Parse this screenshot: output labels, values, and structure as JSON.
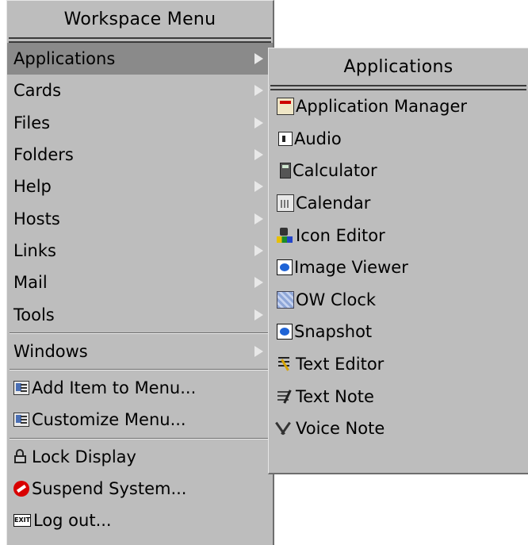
{
  "workspace_menu": {
    "title": "Workspace Menu",
    "submenu_items": [
      {
        "label": "Applications"
      },
      {
        "label": "Cards"
      },
      {
        "label": "Files"
      },
      {
        "label": "Folders"
      },
      {
        "label": "Help"
      },
      {
        "label": "Hosts"
      },
      {
        "label": "Links"
      },
      {
        "label": "Mail"
      },
      {
        "label": "Tools"
      }
    ],
    "windows_item": {
      "label": "Windows"
    },
    "menu_actions": [
      {
        "label": "Add Item to Menu...",
        "icon": "workspace-menu-icon"
      },
      {
        "label": "Customize Menu...",
        "icon": "workspace-menu-icon"
      }
    ],
    "system_actions": [
      {
        "label": "Lock Display",
        "icon": "lock-icon"
      },
      {
        "label": "Suspend System...",
        "icon": "suspend-icon"
      },
      {
        "label": "Log out...",
        "icon": "exit-icon",
        "icon_text": "EXIT"
      }
    ]
  },
  "applications_menu": {
    "title": "Applications",
    "items": [
      {
        "label": "Application Manager",
        "icon": "application-manager-icon"
      },
      {
        "label": "Audio",
        "icon": "audio-icon"
      },
      {
        "label": "Calculator",
        "icon": "calculator-icon"
      },
      {
        "label": "Calendar",
        "icon": "calendar-icon"
      },
      {
        "label": "Icon Editor",
        "icon": "icon-editor-icon"
      },
      {
        "label": "Image Viewer",
        "icon": "image-viewer-icon"
      },
      {
        "label": "OW Clock",
        "icon": "clock-icon"
      },
      {
        "label": "Snapshot",
        "icon": "snapshot-icon"
      },
      {
        "label": "Text Editor",
        "icon": "text-editor-icon"
      },
      {
        "label": "Text Note",
        "icon": "text-note-icon"
      },
      {
        "label": "Voice Note",
        "icon": "voice-note-icon"
      }
    ]
  }
}
